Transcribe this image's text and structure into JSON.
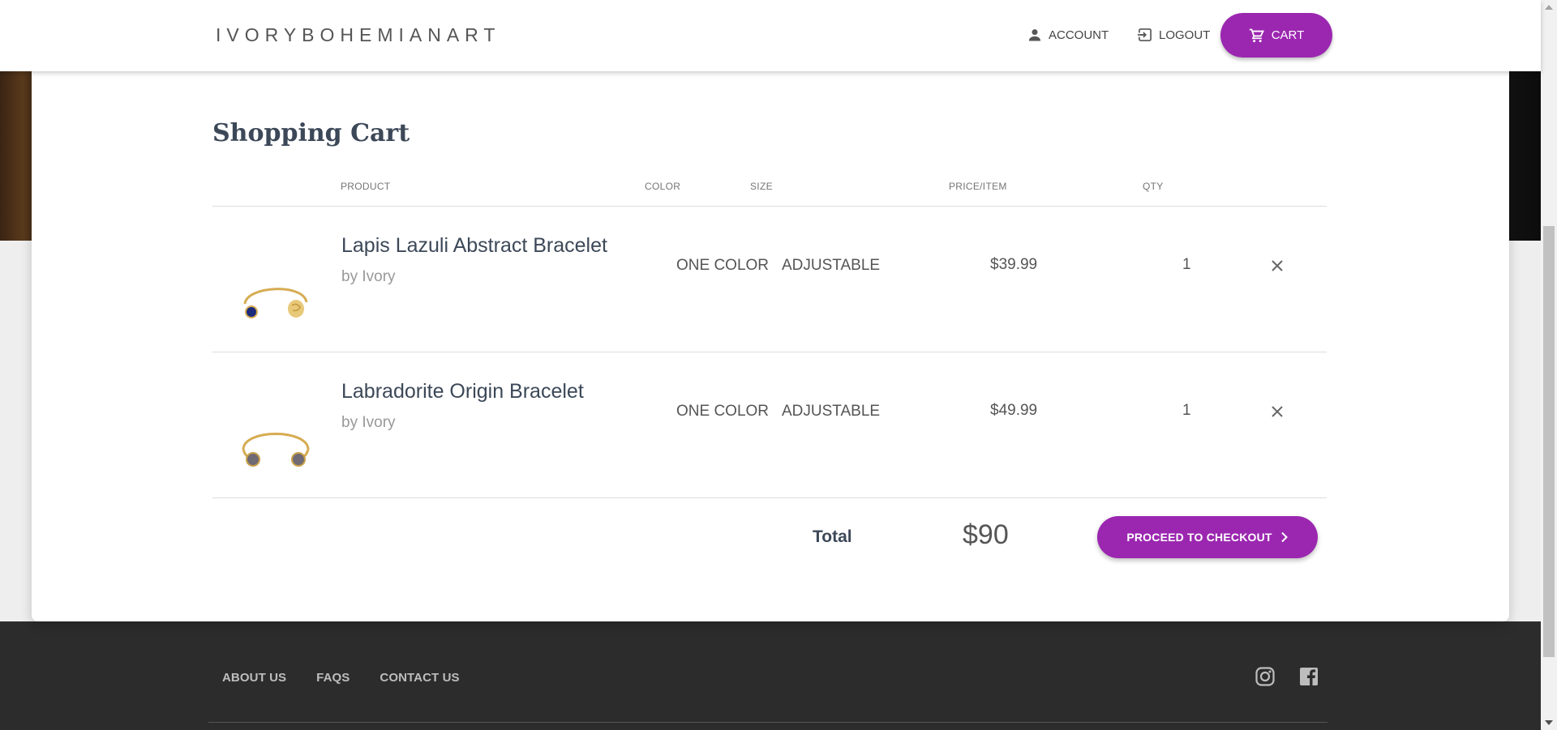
{
  "header": {
    "brand": "IVORYBOHEMIANART",
    "account_label": "ACCOUNT",
    "logout_label": "LOGOUT",
    "cart_label": "CART"
  },
  "cart": {
    "title": "Shopping Cart",
    "columns": {
      "product": "PRODUCT",
      "color": "COLOR",
      "size": "SIZE",
      "price": "PRICE/ITEM",
      "qty": "QTY"
    },
    "items": [
      {
        "name": "Lapis Lazuli Abstract Bracelet",
        "by": "by Ivory",
        "color": "ONE COLOR",
        "size": "ADJUSTABLE",
        "price": "$39.99",
        "qty": "1"
      },
      {
        "name": "Labradorite Origin Bracelet",
        "by": "by Ivory",
        "color": "ONE COLOR",
        "size": "ADJUSTABLE",
        "price": "$49.99",
        "qty": "1"
      }
    ],
    "total_label": "Total",
    "total_value": "$90",
    "checkout_label": "PROCEED TO CHECKOUT"
  },
  "footer": {
    "links": [
      "ABOUT US",
      "FAQS",
      "CONTACT US"
    ]
  },
  "colors": {
    "accent": "#9b27b0",
    "heading": "#3c4858",
    "footer_bg": "#2c2c2c"
  },
  "icons": {
    "account": "person-icon",
    "logout": "logout-icon",
    "cart": "cart-icon",
    "remove": "close-icon",
    "checkout": "chevron-right-icon",
    "social": [
      "instagram-icon",
      "facebook-icon"
    ]
  }
}
